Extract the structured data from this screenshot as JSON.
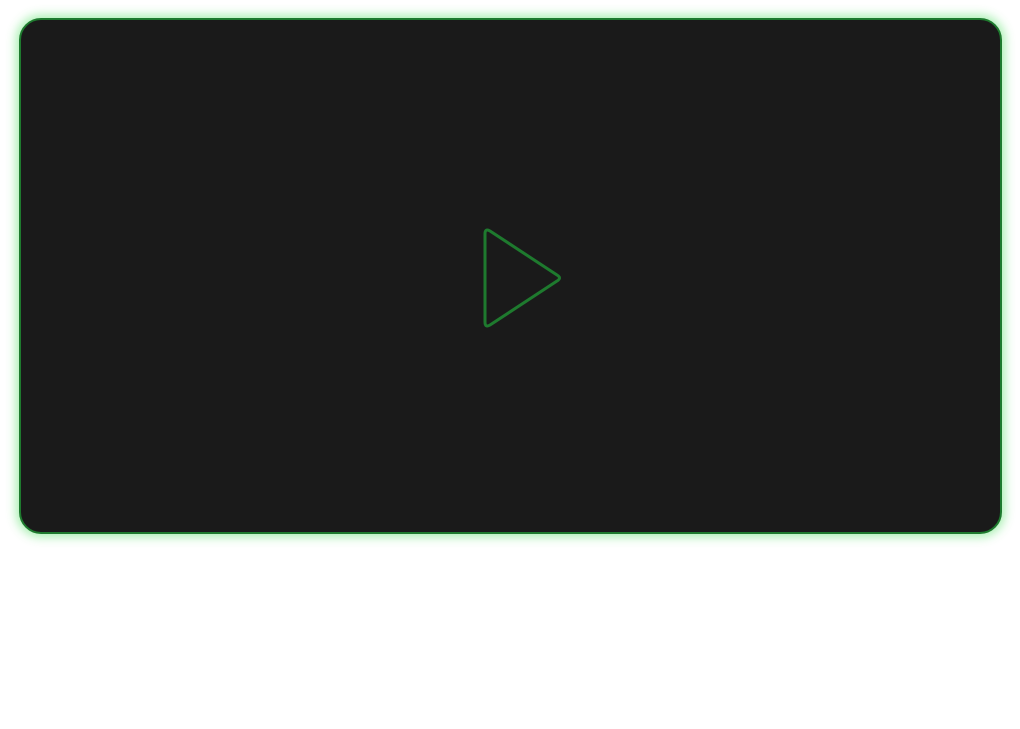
{
  "player": {
    "accent_color": "#1e7a2e",
    "glow_color": "#3cdc50",
    "background_color": "#1a1a1a",
    "play_icon": "play-icon"
  }
}
